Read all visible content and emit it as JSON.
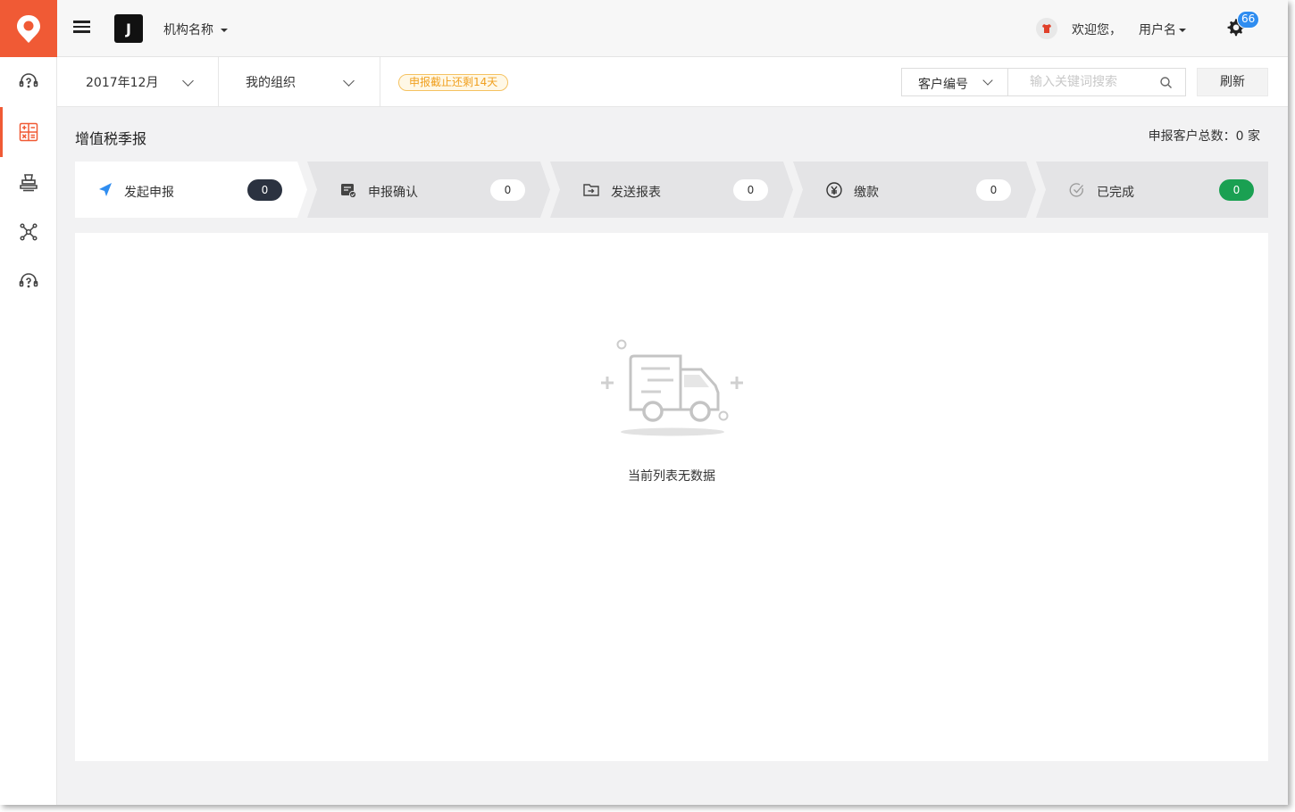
{
  "topbar": {
    "org_name": "机构名称",
    "welcome": "欢迎您，",
    "username": "用户名",
    "notification_count": "66",
    "org_logo_glyph": "J"
  },
  "sidebar": {
    "items": [
      {
        "icon": "customer-service-icon",
        "active": false
      },
      {
        "icon": "calculator-icon",
        "active": true
      },
      {
        "icon": "stamp-icon",
        "active": false
      },
      {
        "icon": "network-icon",
        "active": false
      },
      {
        "icon": "help-icon",
        "active": false
      }
    ]
  },
  "filters": {
    "period": "2017年12月",
    "organization": "我的组织",
    "deadline_notice": "申报截止还剩14天",
    "customer_field": "客户编号",
    "search_placeholder": "输入关键词搜索",
    "refresh_label": "刷新"
  },
  "page": {
    "title": "增值税季报",
    "total_label": "申报客户总数：0 家"
  },
  "steps": [
    {
      "label": "发起申报",
      "count": "0",
      "icon": "navigation-arrow-icon",
      "active": true
    },
    {
      "label": "申报确认",
      "count": "0",
      "icon": "confirm-doc-icon",
      "active": false
    },
    {
      "label": "发送报表",
      "count": "0",
      "icon": "send-folder-icon",
      "active": false
    },
    {
      "label": "缴款",
      "count": "0",
      "icon": "yuan-payment-icon",
      "active": false
    },
    {
      "label": "已完成",
      "count": "0",
      "icon": "check-circle-icon",
      "active": false
    }
  ],
  "empty_state": {
    "message": "当前列表无数据"
  },
  "colors": {
    "brand": "#f05a35",
    "badge": "#2f8df0",
    "active_count": "#2b3240",
    "done_count": "#1aa052",
    "deadline": "#f0a020"
  }
}
